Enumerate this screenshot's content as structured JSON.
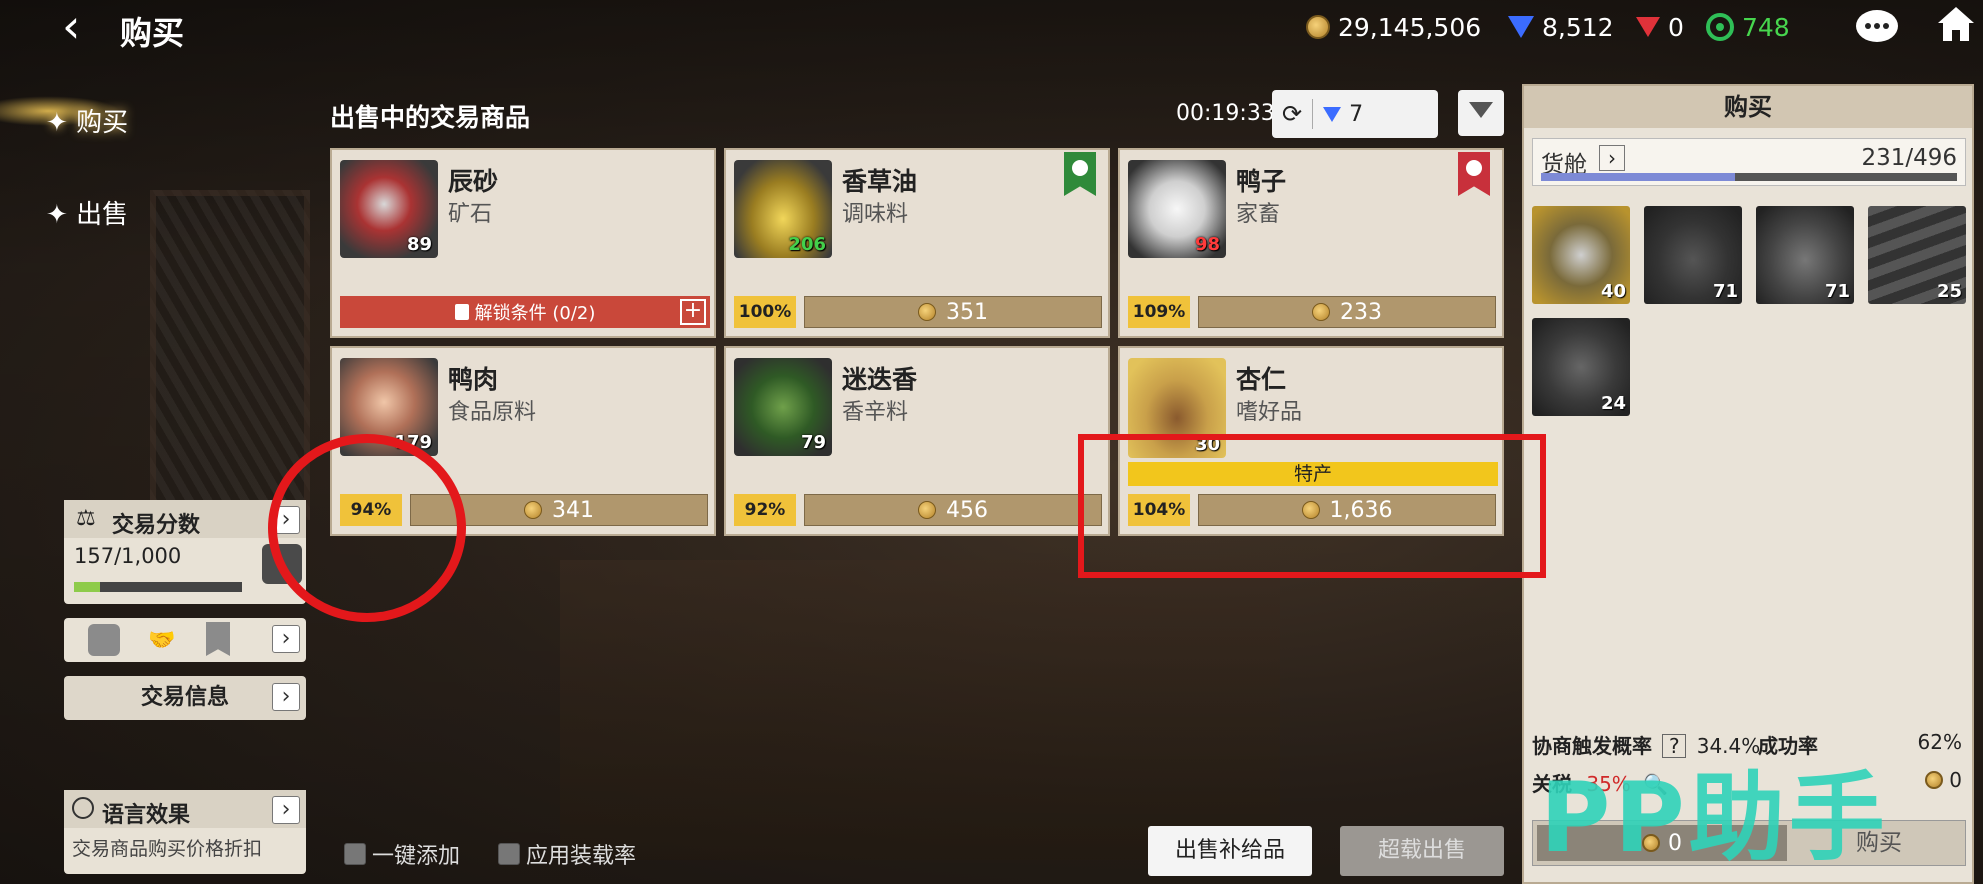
{
  "header": {
    "title": "购买",
    "gold": "29,145,506",
    "blue_gems": "8,512",
    "red_gems": "0",
    "wheel_points": "748"
  },
  "nav": {
    "buy": "购买",
    "sell": "出售"
  },
  "trade_score": {
    "label": "交易分数",
    "value": "157/1,000",
    "progress": 0.157
  },
  "trade_info": "交易信息",
  "language_effect": {
    "label": "语言效果",
    "desc": "交易商品购买价格折扣"
  },
  "goods_header": {
    "title": "出售中的交易商品",
    "timer": "00:19:33",
    "refresh_cost": "7"
  },
  "goods": [
    {
      "name": "辰砂",
      "category": "矿石",
      "qty": "89",
      "qty_color": "#ffffff",
      "locked": true,
      "unlock_text": "解锁条件 (0/2)"
    },
    {
      "name": "香草油",
      "category": "调味料",
      "qty": "206",
      "qty_color": "#43d04b",
      "percent": "100%",
      "price": "351",
      "flag": "green"
    },
    {
      "name": "鸭子",
      "category": "家畜",
      "qty": "98",
      "qty_color": "#ff3b3b",
      "percent": "109%",
      "price": "233",
      "flag": "red"
    },
    {
      "name": "鸭肉",
      "category": "食品原料",
      "qty": "179",
      "qty_color": "#ffffff",
      "percent": "94%",
      "price": "341"
    },
    {
      "name": "迷迭香",
      "category": "香辛料",
      "qty": "79",
      "qty_color": "#ffffff",
      "percent": "92%",
      "price": "456"
    },
    {
      "name": "杏仁",
      "category": "嗜好品",
      "qty": "30",
      "qty_color": "#ffffff",
      "percent": "104%",
      "price": "1,636",
      "special": "特产"
    }
  ],
  "right_panel": {
    "title": "购买",
    "hold_label": "货舱",
    "hold_value": "231/496",
    "hold_progress": 0.466,
    "cargo": [
      {
        "qty": "40"
      },
      {
        "qty": "71"
      },
      {
        "qty": "71"
      },
      {
        "qty": "25"
      },
      {
        "qty": "24"
      }
    ],
    "negotiate_label": "协商触发概率",
    "negotiate_value": "34.4%",
    "success_label": "成功率",
    "success_value": "62%",
    "tax_label": "关税",
    "tax_value": "35%",
    "tax_cost": "0",
    "total_cost": "0",
    "buy_button": "购买"
  },
  "bottom": {
    "add_all": "一键添加",
    "apply_load": "应用装载率",
    "sell_supplies": "出售补给品",
    "overload_sell": "超载出售"
  },
  "watermark": "PP助手"
}
